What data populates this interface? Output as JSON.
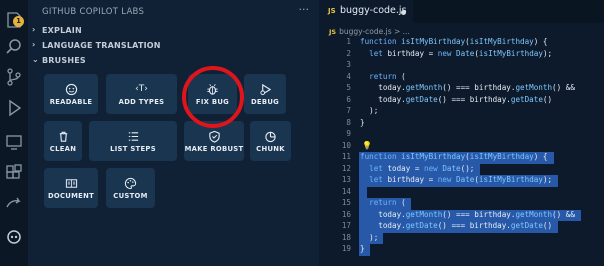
{
  "activity_bar": {
    "icons": [
      "copilot-labs-icon",
      "search-icon",
      "source-control-icon",
      "run-debug-icon",
      "remote-explorer-icon",
      "extensions-icon",
      "live-share-icon",
      "github-copilot-icon"
    ],
    "badge": "1"
  },
  "sidebar": {
    "title": "GITHUB COPILOT LABS",
    "more": "···",
    "sections": [
      {
        "chevron": "›",
        "label": "EXPLAIN"
      },
      {
        "chevron": "›",
        "label": "LANGUAGE TRANSLATION"
      },
      {
        "chevron": "⌄",
        "label": "BRUSHES"
      }
    ],
    "brushes": [
      {
        "label": "READABLE",
        "icon": "smiley-icon"
      },
      {
        "label": "ADD TYPES",
        "icon": "type-icon",
        "glyph": "‹T›"
      },
      {
        "label": "FIX BUG",
        "icon": "bug-icon"
      },
      {
        "label": "DEBUG",
        "icon": "debug-icon"
      },
      {
        "label": "CLEAN",
        "icon": "trash-icon"
      },
      {
        "label": "LIST STEPS",
        "icon": "list-icon"
      },
      {
        "label": "MAKE ROBUST",
        "icon": "shield-icon"
      },
      {
        "label": "CHUNK",
        "icon": "pie-icon"
      },
      {
        "label": "DOCUMENT",
        "icon": "document-icon"
      },
      {
        "label": "CUSTOM",
        "icon": "palette-icon"
      }
    ]
  },
  "editor": {
    "tab_label": "buggy-code.js",
    "tab_lang": "JS",
    "breadcrumb": "buggy-code.js > ...",
    "lines": [
      {
        "n": "1",
        "code": "function isItMyBirthday(isItMyBirthday) {"
      },
      {
        "n": "2",
        "code": "  let birthday = new Date(isItMyBirthday);"
      },
      {
        "n": "3",
        "code": ""
      },
      {
        "n": "4",
        "code": "  return ("
      },
      {
        "n": "5",
        "code": "    today.getMonth() === birthday.getMonth() &&"
      },
      {
        "n": "6",
        "code": "    today.getDate() === birthday.getDate()"
      },
      {
        "n": "7",
        "code": "  );"
      },
      {
        "n": "8",
        "code": "}"
      },
      {
        "n": "9",
        "code": ""
      },
      {
        "n": "10",
        "code": ""
      },
      {
        "n": "11",
        "code": "function isItMyBirthday(isItMyBirthday) {"
      },
      {
        "n": "12",
        "code": "  let today = new Date();"
      },
      {
        "n": "13",
        "code": "  let birthday = new Date(isItMyBirthday);"
      },
      {
        "n": "14",
        "code": ""
      },
      {
        "n": "15",
        "code": "  return ("
      },
      {
        "n": "16",
        "code": "    today.getMonth() === birthday.getMonth() &&"
      },
      {
        "n": "17",
        "code": "    today.getDate() === birthday.getDate()"
      },
      {
        "n": "18",
        "code": "  );"
      },
      {
        "n": "19",
        "code": "}"
      }
    ]
  },
  "colors": {
    "sidebar_bg": "#112135",
    "brush_bg": "#1a3550",
    "editor_bg": "#0d1a2b",
    "selection": "#2759a8",
    "annotation_circle": "#e0141b"
  }
}
